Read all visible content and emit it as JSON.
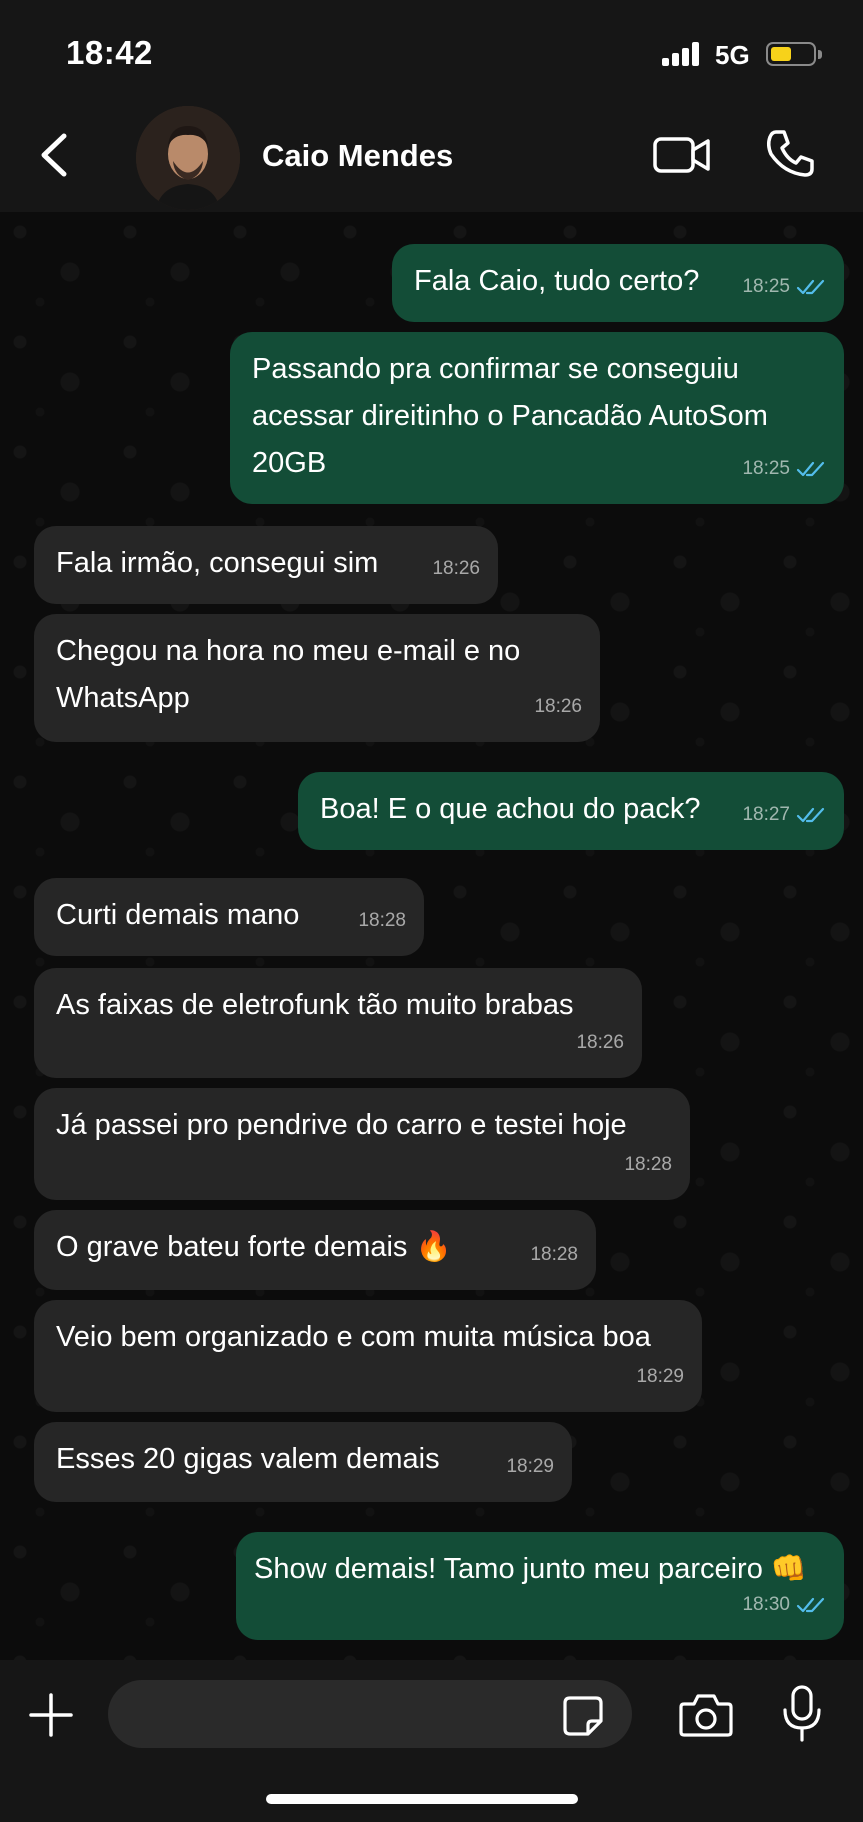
{
  "status_bar": {
    "time": "18:42",
    "network": "5G",
    "battery_level": 0.5,
    "battery_color": "#f7d21a"
  },
  "header": {
    "contact_name": "Caio Mendes",
    "icons": [
      "chevron-left-icon",
      "video-camera-icon",
      "phone-icon"
    ]
  },
  "messages": [
    {
      "direction": "out",
      "text": "Fala Caio, tudo certo?",
      "time": "18:25",
      "read": true
    },
    {
      "direction": "out",
      "text": "Passando pra confirmar se conseguiu acessar direitinho o Pancadão AutoSom 20GB",
      "time": "18:25",
      "read": true
    },
    {
      "direction": "in",
      "text": "Fala irmão, consegui sim",
      "time": "18:26"
    },
    {
      "direction": "in",
      "text": "Chegou na hora no meu e-mail e no WhatsApp",
      "time": "18:26"
    },
    {
      "direction": "out",
      "text": "Boa! E o que achou do pack?",
      "time": "18:27",
      "read": true
    },
    {
      "direction": "in",
      "text": "Curti demais mano",
      "time": "18:28"
    },
    {
      "direction": "in",
      "text": "As faixas de eletrofunk tão muito brabas",
      "time": "18:26"
    },
    {
      "direction": "in",
      "text": "Já passei pro pendrive do carro e testei hoje",
      "time": "18:28"
    },
    {
      "direction": "in",
      "text": "O grave bateu forte demais 🔥",
      "time": "18:28"
    },
    {
      "direction": "in",
      "text": "Veio bem organizado e com muita música boa",
      "time": "18:29"
    },
    {
      "direction": "in",
      "text": "Esses 20 gigas valem demais",
      "time": "18:29"
    },
    {
      "direction": "out",
      "text": "Show demais! Tamo junto meu parceiro 👊",
      "time": "18:30",
      "read": true
    }
  ],
  "composer": {
    "value": "",
    "placeholder": ""
  },
  "colors": {
    "outgoing_bubble": "#134d37",
    "incoming_bubble": "#262626",
    "read_ticks": "#53bdeb"
  }
}
